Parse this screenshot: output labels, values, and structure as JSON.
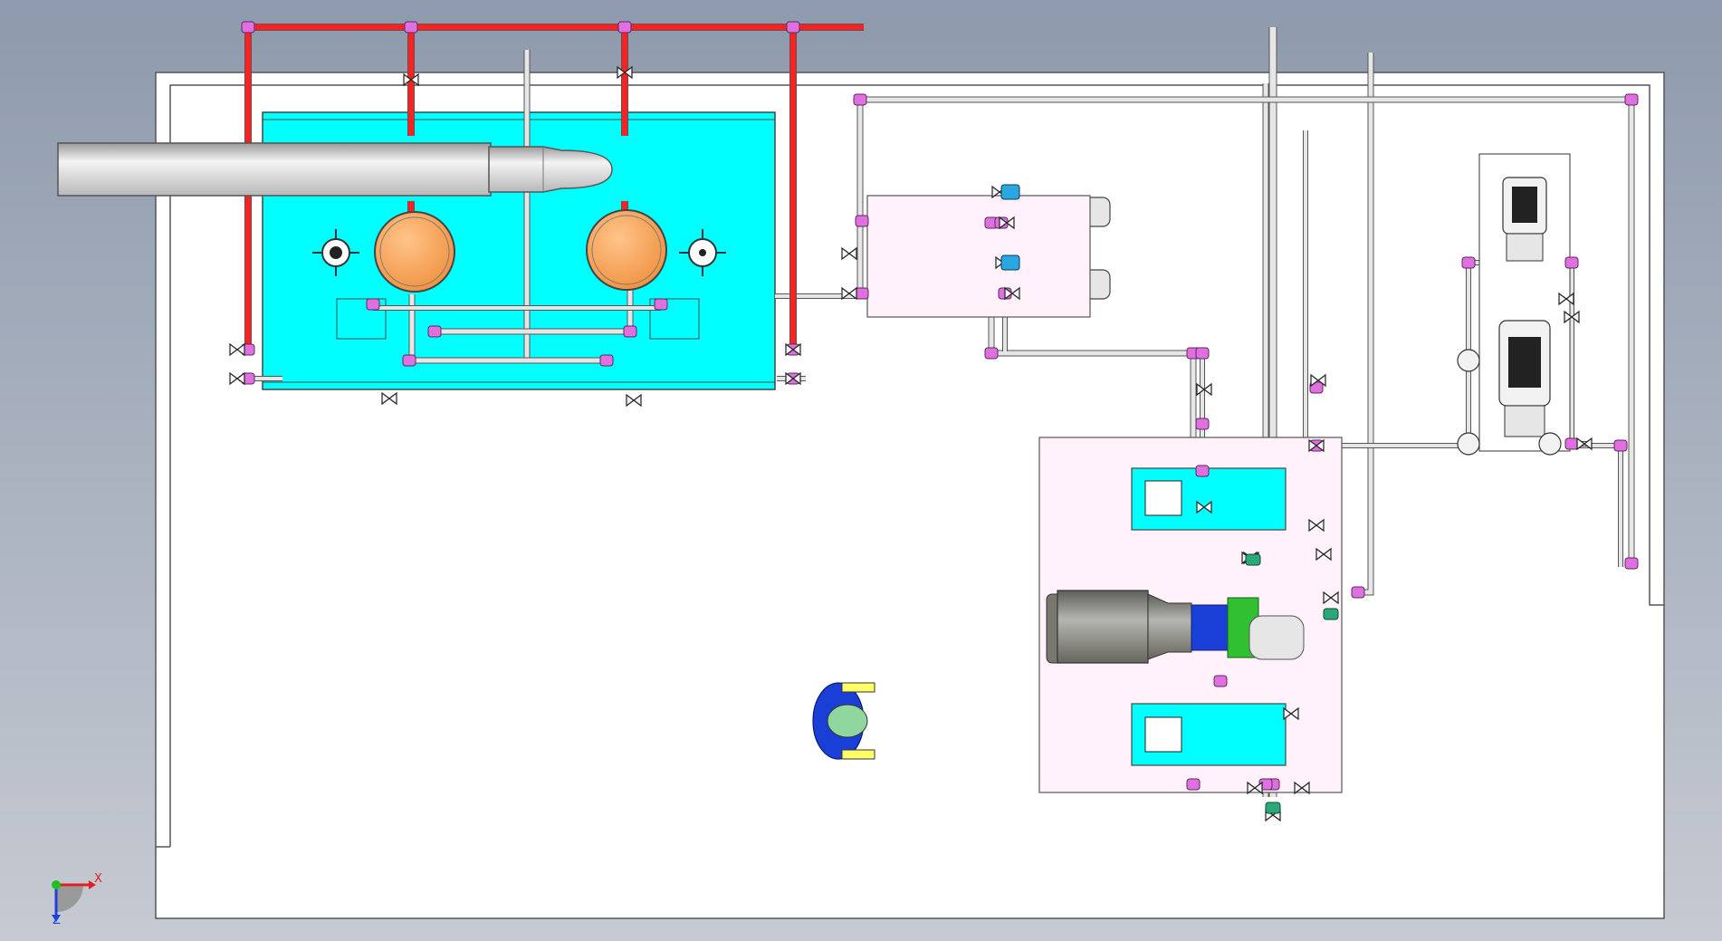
{
  "colors": {
    "background_top": "#8e9aad",
    "background_bottom": "#c6cad2",
    "room_fill": "#ffffff",
    "room_stroke": "#555555",
    "tank_fill": "#00ffff",
    "pipe_red": "#ff2020",
    "pipe_gray": "#e6e6e6",
    "pipe_stroke": "#555555",
    "fitting_magenta": "#e070e0",
    "vessel_orange": "#f7a25a",
    "skid_fill": "#fff2fb",
    "motor_gray": "#8a8a86",
    "pump_blue": "#1a3fd6",
    "pump_green": "#30c030",
    "triad_x": "#e02020",
    "triad_y": "#20c020",
    "triad_z": "#2040e0"
  },
  "icons": {
    "exhaust_duct": "duct-icon",
    "vessel": "pressure-vessel-icon",
    "valve": "valve-icon",
    "vertical_pump": "vertical-pump-icon",
    "horizontal_pump": "horizontal-pump-icon",
    "operator": "human-figure-icon",
    "triad": "coordinate-triad-icon"
  },
  "triad": {
    "x_label": "X",
    "z_label": "Z"
  }
}
